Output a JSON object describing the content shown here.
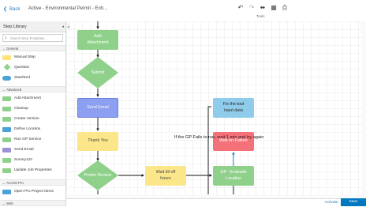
{
  "header": {
    "back_label": "Back",
    "title": "Active - Environmental Permit - Enh...",
    "tools_label": "Tools",
    "tools": [
      "undo-icon",
      "redo-icon",
      "fit-view-icon",
      "grid-icon",
      "print-icon"
    ]
  },
  "sidebar": {
    "title": "Step Library",
    "search_placeholder": "Search Step Templates...",
    "groups": [
      {
        "label": "General",
        "items": [
          {
            "label": "Manual Step",
            "color": "#ffe37a",
            "shape": "rect"
          },
          {
            "label": "Question",
            "color": "#8fd18a",
            "shape": "diamond"
          },
          {
            "label": "Start/End",
            "color": "#4aa3d8",
            "shape": "pill"
          }
        ]
      },
      {
        "label": "Advanced",
        "items": [
          {
            "label": "Add Attachment",
            "color": "#8fd18a",
            "shape": "rect"
          },
          {
            "label": "Cleanup",
            "color": "#8fd18a",
            "shape": "rect"
          },
          {
            "label": "Create Version",
            "color": "#8fd18a",
            "shape": "rect"
          },
          {
            "label": "Define Location",
            "color": "#4aa3d8",
            "shape": "rect"
          },
          {
            "label": "Run GP Service",
            "color": "#8fd18a",
            "shape": "rect"
          },
          {
            "label": "Send Email",
            "color": "#9c8fd8",
            "shape": "rect"
          },
          {
            "label": "Survey123",
            "color": "#8fd18a",
            "shape": "rect"
          },
          {
            "label": "Update Job Properties",
            "color": "#8fd18a",
            "shape": "rect"
          }
        ]
      },
      {
        "label": "ArcGIS Pro",
        "items": [
          {
            "label": "Open Pro Project Items",
            "color": "#4aa3d8",
            "shape": "rect"
          }
        ]
      },
      {
        "label": "Web",
        "items": []
      }
    ]
  },
  "diagram": {
    "nodes": {
      "add_attachment": "Add\nAttachment",
      "submit": "Submit",
      "send_email": "Send Email",
      "thank_you": "Thank You",
      "prelim_review": "Prelim Review",
      "wait_till_off_hours": "Wait till off\nhours",
      "gp_evaluate": "GP - Evaluate\nLocation",
      "wait_on_failure": "Wait on Failure",
      "fix_bad_input": "Fix the bad\ninput data"
    },
    "annotation": "If the GP Fails to run, wait 1 min and try again"
  },
  "footer": {
    "activate_label": "Activate",
    "save_label": "Save"
  },
  "colors": {
    "green": "#8fd18a",
    "blue": "#8fcbea",
    "purple": "#8c9ff0",
    "yellow": "#fbe68a",
    "red": "#f57179",
    "accent": "#0079c1"
  }
}
